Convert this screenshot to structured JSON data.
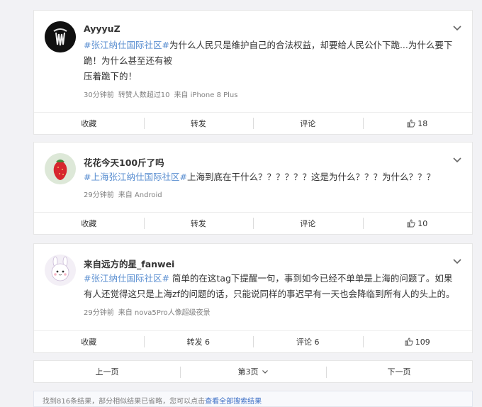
{
  "posts": [
    {
      "username": "AyyyuZ",
      "tag": "#张江纳仕国际社区#",
      "text_line1": "为什么人民只是维护自己的合法权益，却要给人民公仆下跪...为什么要下跪！为什么甚至还有被",
      "text_line2": "压着跪下的！",
      "meta_time": "30分钟前",
      "meta_extra": "转赞人数超过10",
      "meta_source": "来自 iPhone 8 Plus",
      "actions": {
        "collect": "收藏",
        "repost": "转发",
        "comment": "评论",
        "like": "18"
      }
    },
    {
      "username": "花花今天100斤了吗",
      "tag": "#上海张江纳仕国际社区#",
      "text": "上海到底在干什么？？？？？？这是为什么？？？为什么？？？",
      "meta_time": "29分钟前",
      "meta_source": "来自 Android",
      "actions": {
        "collect": "收藏",
        "repost": "转发",
        "comment": "评论",
        "like": "10"
      }
    },
    {
      "username": "来自远方的星_fanwei",
      "tag": "#张江纳仕国际社区#",
      "text_line1": " 简单的在这tag下提醒一句，事到如今已经不单单是上海的问题了。如果",
      "text_line2": "有人还觉得这只是上海zf的问题的话，只能说同样的事迟早有一天也会降临到所有人的头上的。",
      "meta_time": "29分钟前",
      "meta_source": "来自 nova5Pro人像超级夜景",
      "actions": {
        "collect": "收藏",
        "repost": "转发 6",
        "comment": "评论 6",
        "like": "109"
      }
    }
  ],
  "pagination": {
    "prev": "上一页",
    "current": "第3页",
    "next": "下一页"
  },
  "notice": {
    "text": "找到816条结果，部分相似结果已省略，您可以点击",
    "link": "查看全部搜索结果"
  },
  "colors": {
    "tag": "#5b8fd1",
    "link": "#3d70c6",
    "background": "#f2f2f5"
  },
  "icons": [
    "chevron-down-icon",
    "thumbs-up-icon",
    "avatar"
  ]
}
